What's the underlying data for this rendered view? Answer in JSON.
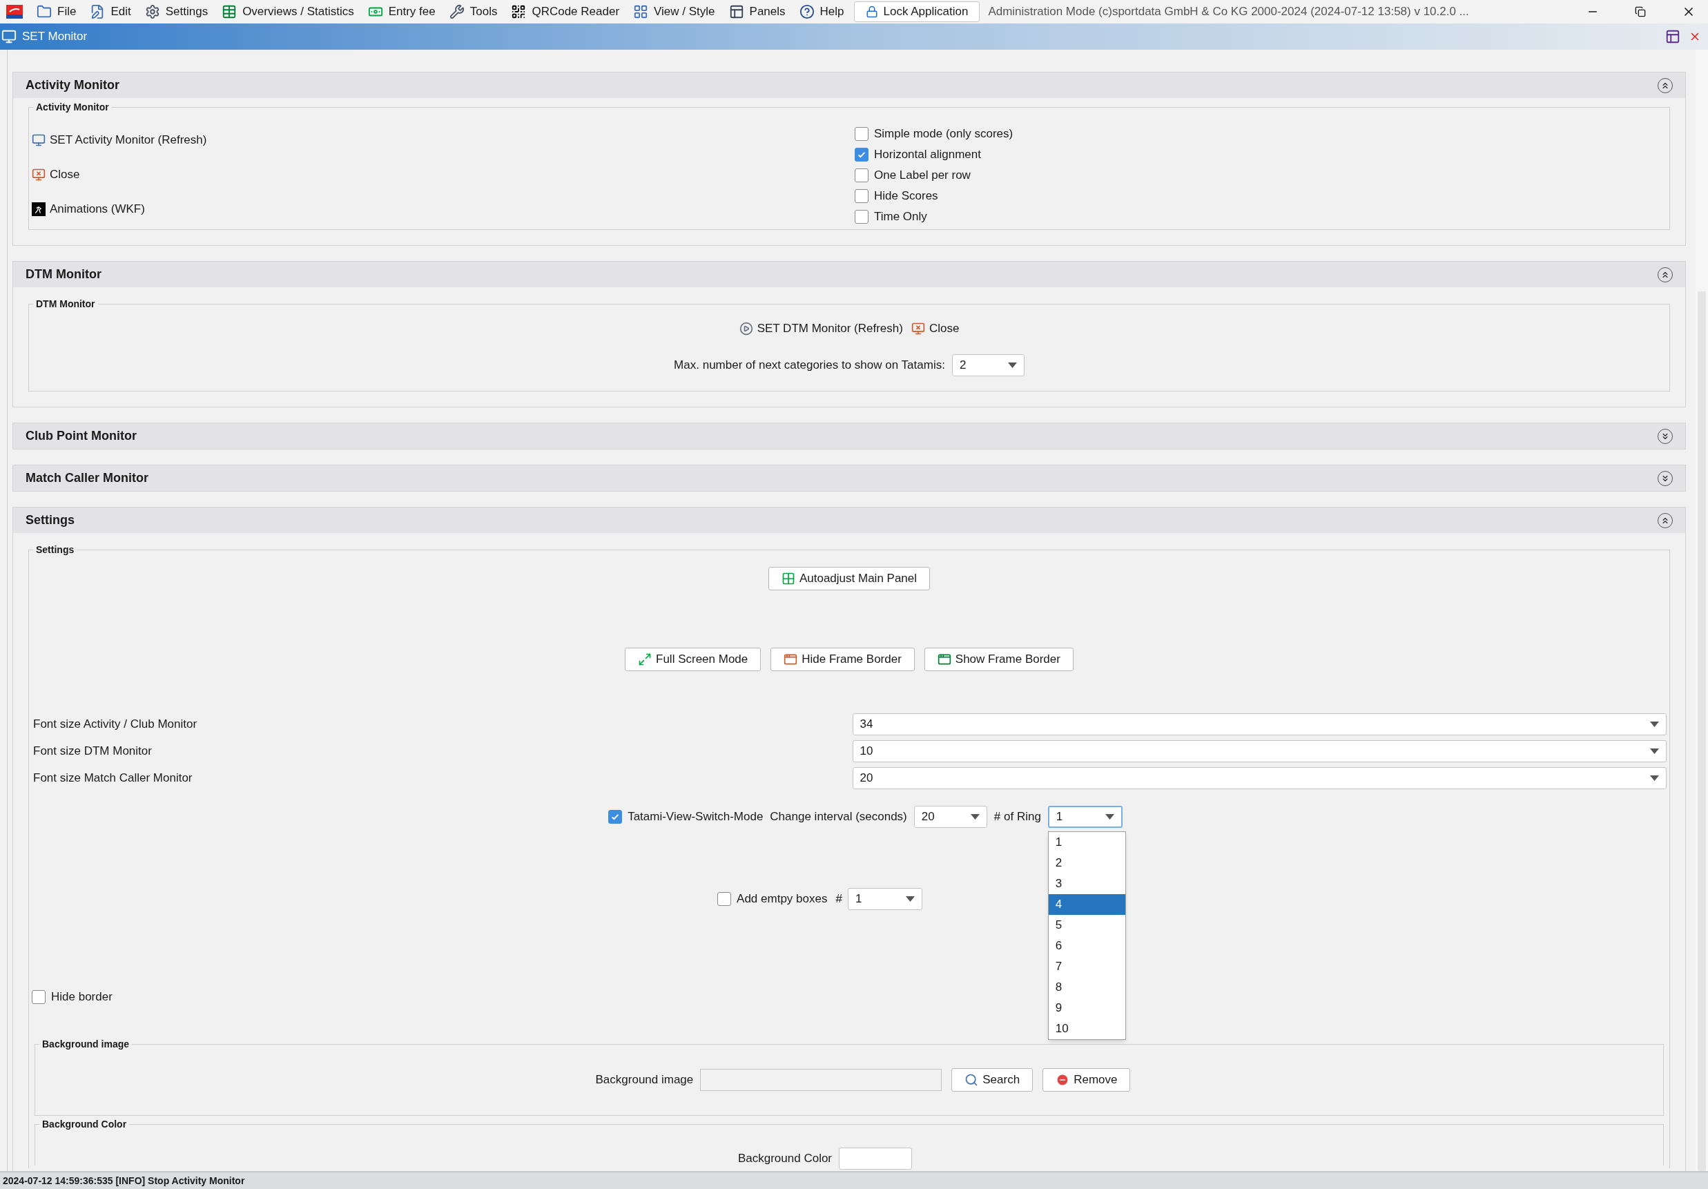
{
  "menu_bar": {
    "items": [
      {
        "label": "File"
      },
      {
        "label": "Edit"
      },
      {
        "label": "Settings"
      },
      {
        "label": "Overviews / Statistics"
      },
      {
        "label": "Entry fee"
      },
      {
        "label": "Tools"
      },
      {
        "label": "QRCode Reader"
      },
      {
        "label": "View / Style"
      },
      {
        "label": "Panels"
      },
      {
        "label": "Help"
      }
    ],
    "lock_button": "Lock Application",
    "app_info": "Administration Mode (c)sportdata GmbH & Co KG 2000-2024 (2024-07-12 13:58)  v 10.2.0 ..."
  },
  "window": {
    "title": "SET Monitor"
  },
  "sections": [
    {
      "kind": "activity",
      "title": "Activity Monitor",
      "expanded": true,
      "group_title": "Activity Monitor",
      "actions": [
        "SET Activity Monitor (Refresh)",
        "Close",
        "Animations (WKF)"
      ],
      "options": [
        {
          "label": "Simple mode (only scores)",
          "checked": false
        },
        {
          "label": "Horizontal alignment",
          "checked": true
        },
        {
          "label": "One Label per row",
          "checked": false
        },
        {
          "label": "Hide Scores",
          "checked": false
        },
        {
          "label": "Time Only",
          "checked": false
        }
      ]
    },
    {
      "kind": "dtm",
      "title": "DTM Monitor",
      "expanded": true,
      "group_title": "DTM Monitor",
      "actions": [
        "SET DTM Monitor (Refresh)",
        "Close"
      ],
      "max_label": "Max. number of next categories to show on Tatamis:",
      "max_value": "2"
    },
    {
      "kind": "plain",
      "title": "Club Point Monitor",
      "expanded": false
    },
    {
      "kind": "plain",
      "title": "Match Caller Monitor",
      "expanded": false
    },
    {
      "kind": "settings",
      "title": "Settings",
      "expanded": true,
      "group_title": "Settings",
      "autoadjust_button": "Autoadjust Main Panel",
      "frame_buttons": [
        "Full Screen Mode",
        "Hide Frame Border",
        "Show Frame Border"
      ],
      "font_sizes": [
        {
          "label": "Font size Activity / Club Monitor",
          "value": "34"
        },
        {
          "label": "Font size DTM Monitor",
          "value": "10"
        },
        {
          "label": "Font size Match Caller Monitor",
          "value": "20"
        }
      ],
      "tatami": {
        "label": "Tatami-View-Switch-Mode",
        "checked": true,
        "interval_label": "Change interval (seconds)",
        "interval_value": "20",
        "ring_label": "# of Ring",
        "ring_value": "1",
        "ring_options": [
          {
            "label": "1",
            "selected": false
          },
          {
            "label": "2",
            "selected": false
          },
          {
            "label": "3",
            "selected": false
          },
          {
            "label": "4",
            "selected": true
          },
          {
            "label": "5",
            "selected": false
          },
          {
            "label": "6",
            "selected": false
          },
          {
            "label": "7",
            "selected": false
          },
          {
            "label": "8",
            "selected": false
          },
          {
            "label": "9",
            "selected": false
          },
          {
            "label": "10",
            "selected": false
          }
        ]
      },
      "empty_boxes": {
        "label": "Add emtpy boxes",
        "checked": false,
        "count_label": "#",
        "value": "1"
      },
      "hide_border": {
        "label": "Hide border",
        "checked": false
      },
      "background_image": {
        "group_title": "Background image",
        "label": "Background image",
        "search_button": "Search",
        "remove_button": "Remove"
      },
      "background_color": {
        "group_title": "Background Color",
        "label": "Background Color"
      }
    }
  ],
  "status_bar": "2024-07-12 14:59:36:535 [INFO] Stop Activity Monitor"
}
